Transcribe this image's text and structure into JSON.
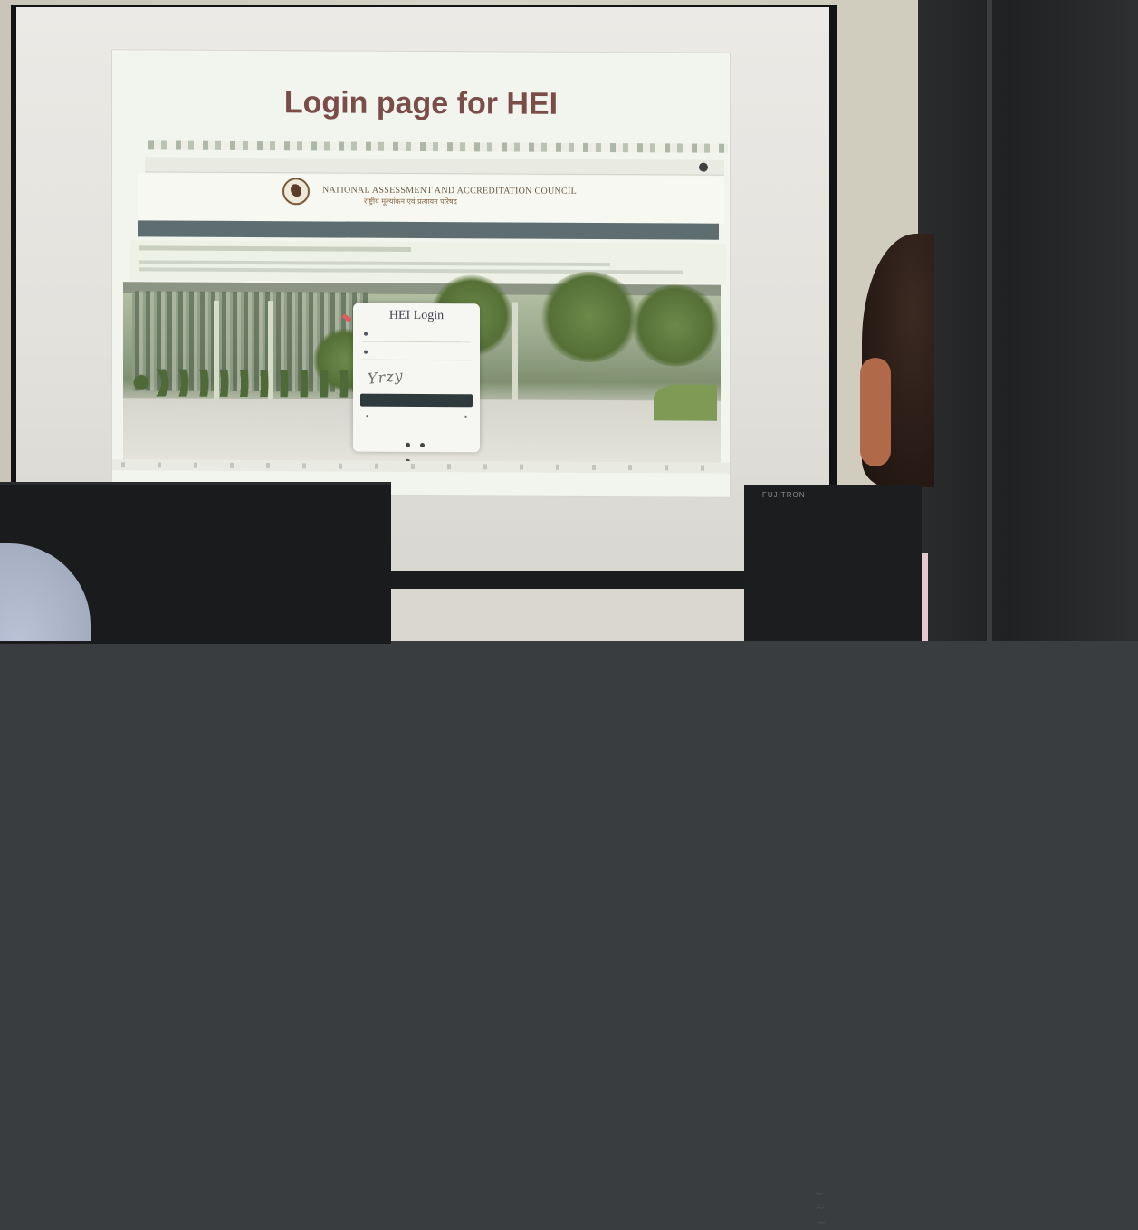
{
  "slide": {
    "title": "Login page for HEI"
  },
  "naac": {
    "title": "NATIONAL ASSESSMENT AND ACCREDITATION COUNCIL",
    "hindi": "राष्ट्रीय मूल्यांकन एवं प्रत्यायन परिषद"
  },
  "login": {
    "title": "HEI Login",
    "captcha": "Yrzy"
  },
  "monitor": {
    "brand_right": "FUJITRON"
  },
  "colors": {
    "slide_title": "#7a4d49",
    "nav_strip": "#5e6e70",
    "login_button": "#2f3a3d"
  }
}
